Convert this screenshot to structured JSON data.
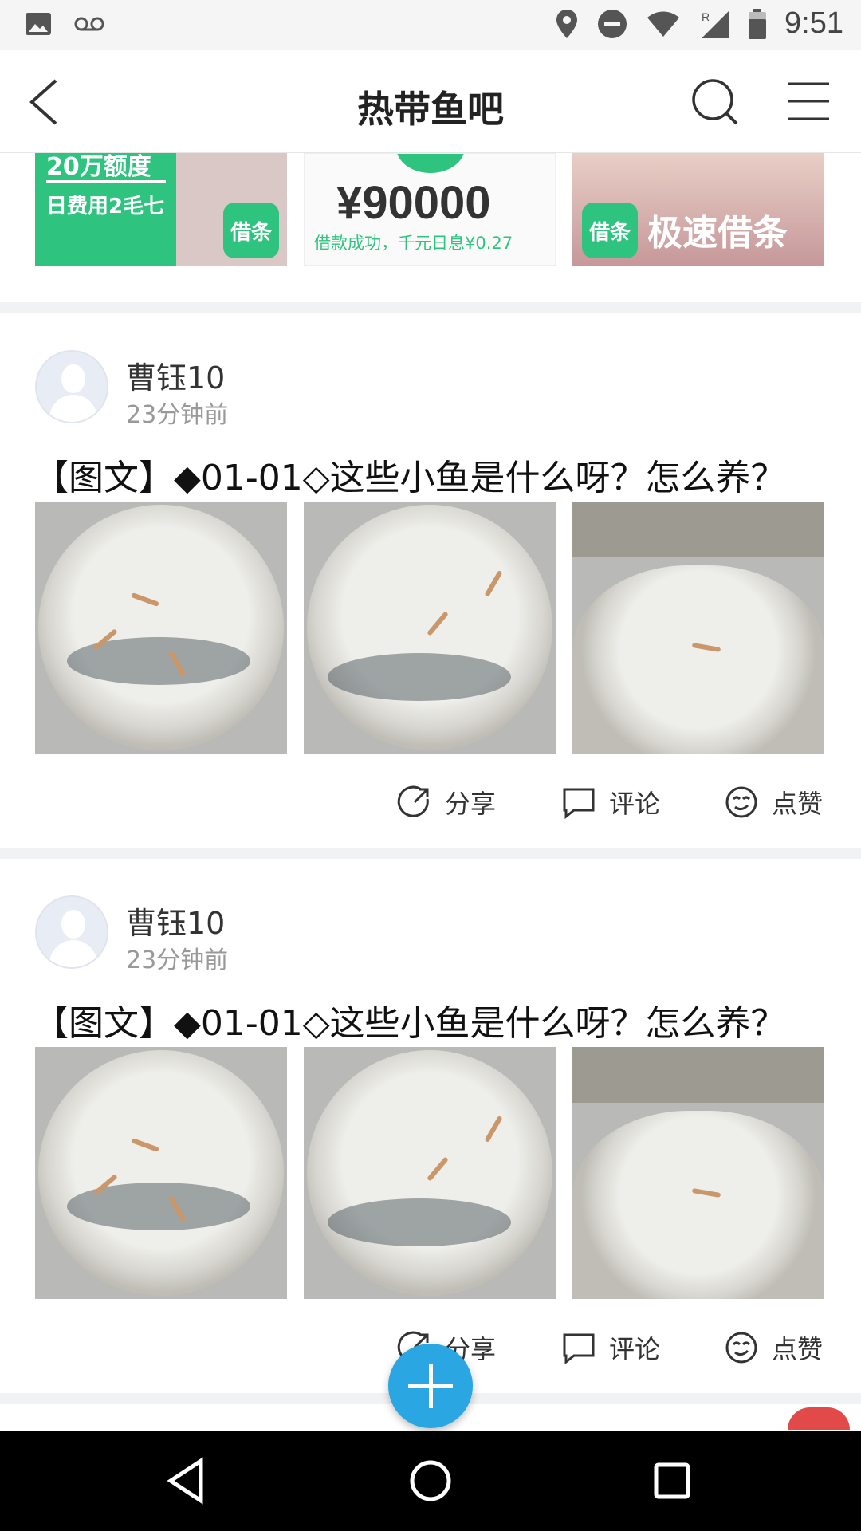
{
  "status_bar": {
    "time": "9:51",
    "left_icons": [
      "image-icon",
      "voicemail-icon"
    ],
    "right_icons": [
      "location-icon",
      "do-not-disturb-icon",
      "wifi-icon",
      "signal-roaming-icon",
      "battery-icon"
    ]
  },
  "header": {
    "title": "热带鱼吧",
    "back_icon": "chevron-left-icon",
    "search_icon": "search-icon",
    "menu_icon": "hamburger-menu-icon"
  },
  "ads": [
    {
      "line1": "20万额度",
      "line2": "日费用2毛七",
      "badge": "借条"
    },
    {
      "amount": "¥90000",
      "subtitle": "借款成功，千元日息¥0.27"
    },
    {
      "badge": "借条",
      "slogan": "极速借条"
    }
  ],
  "posts": [
    {
      "author": "曹钰10",
      "time": "23分钟前",
      "title": "【图文】◆01-01◇这些小鱼是什么呀？怎么养？",
      "actions": {
        "share": "分享",
        "comment": "评论",
        "like": "点赞"
      }
    },
    {
      "author": "曹钰10",
      "time": "23分钟前",
      "title": "【图文】◆01-01◇这些小鱼是什么呀？怎么养？",
      "actions": {
        "share": "分享",
        "comment": "评论",
        "like": "点赞"
      }
    }
  ],
  "fab": {
    "icon": "plus-icon"
  },
  "colors": {
    "accent": "#2aa7e3",
    "ad_green": "#2ec47f",
    "divider": "#f1f2f4"
  },
  "nav": {
    "icons": [
      "back-triangle-icon",
      "home-circle-icon",
      "recents-square-icon"
    ]
  }
}
